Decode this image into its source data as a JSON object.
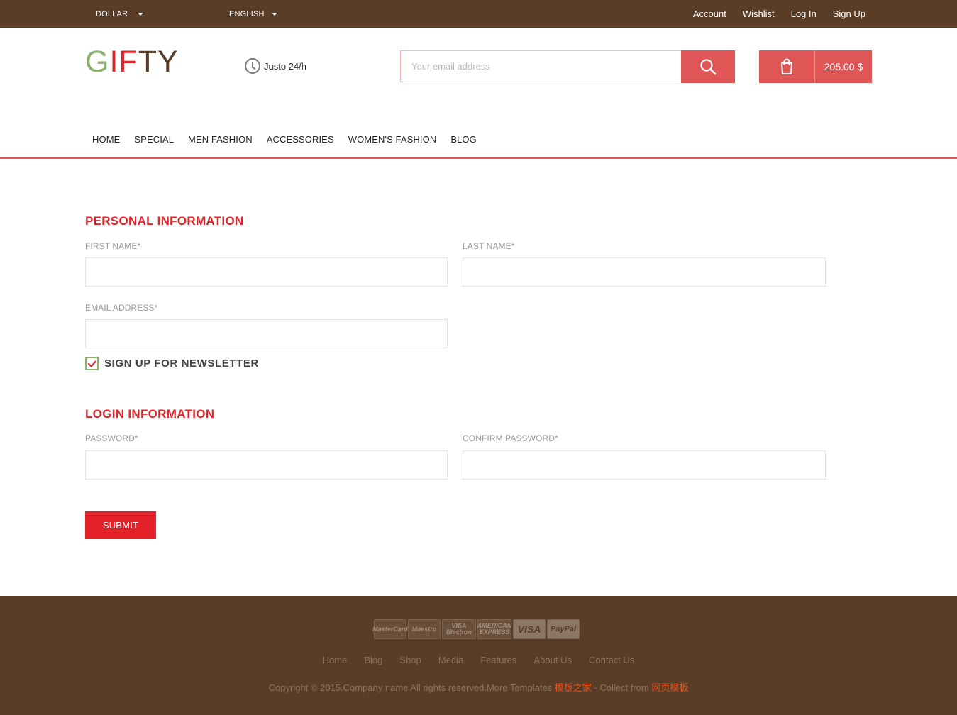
{
  "topbar": {
    "currency": "DOLLAR",
    "language": "ENGLISH",
    "links": [
      "Account",
      "Wishlist",
      "Log In",
      "Sign Up"
    ]
  },
  "header": {
    "logo": {
      "g": "G",
      "i": "I",
      "f": "F",
      "ty": "TY"
    },
    "hours": "Justo 24/h",
    "search_placeholder": "Your email address",
    "cart_total": "205.00 $"
  },
  "nav": {
    "items": [
      "HOME",
      "SPECIAL",
      "MEN FASHION",
      "ACCESSORIES",
      "WOMEN'S FASHION",
      "BLOG"
    ]
  },
  "form": {
    "personal_title": "PERSONAL INFORMATION",
    "first_name_label": "FIRST NAME*",
    "last_name_label": "LAST NAME*",
    "email_label": "EMAIL ADDRESS*",
    "newsletter_label": "SIGN UP FOR NEWSLETTER",
    "newsletter_checked": true,
    "login_title": "LOGIN INFORMATION",
    "password_label": "PASSWORD*",
    "confirm_password_label": "CONFIRM PASSWORD*",
    "submit_label": "SUBMIT"
  },
  "footer": {
    "payments": [
      "MasterCard",
      "Maestro",
      "VISA Electron",
      "AMERICAN EXPRESS",
      "VISA",
      "PayPal"
    ],
    "links": [
      "Home",
      "Blog",
      "Shop",
      "Media",
      "Features",
      "About Us",
      "Contact Us"
    ],
    "copyright_prefix": "Copyright © 2015.Company name All rights reserved.More Templates ",
    "copyright_link1": "模板之家",
    "copyright_mid": " - Collect from ",
    "copyright_link2": "网页模板"
  },
  "colors": {
    "brand_brown": "#5a3d27",
    "accent_red": "#e32129",
    "button_coral": "#e05656",
    "logo_green": "#8ab16f"
  }
}
